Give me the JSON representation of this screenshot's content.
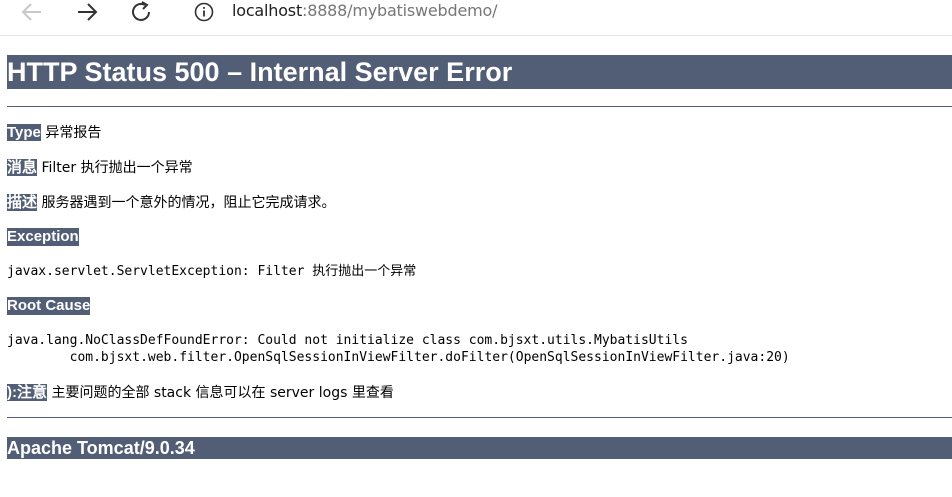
{
  "browser": {
    "url_host": "localhost",
    "url_rest": ":8888/mybatiswebdemo/"
  },
  "page": {
    "title": "HTTP Status 500 – Internal Server Error",
    "type_label": "Type",
    "type_value": "异常报告",
    "message_label": "消息",
    "message_value": "Filter 执行抛出一个异常",
    "description_label": "描述",
    "description_value": "服务器遇到一个意外的情况，阻止它完成请求。",
    "exception_heading": "Exception",
    "exception_text": "javax.servlet.ServletException: Filter 执行抛出一个异常",
    "root_cause_heading": "Root Cause",
    "root_cause_text": "java.lang.NoClassDefFoundError: Could not initialize class com.bjsxt.utils.MybatisUtils\n\tcom.bjsxt.web.filter.OpenSqlSessionInViewFilter.doFilter(OpenSqlSessionInViewFilter.java:20)",
    "note_label": "):注意",
    "note_value": "主要问题的全部 stack 信息可以在 server logs 里查看",
    "footer": "Apache Tomcat/9.0.34"
  }
}
